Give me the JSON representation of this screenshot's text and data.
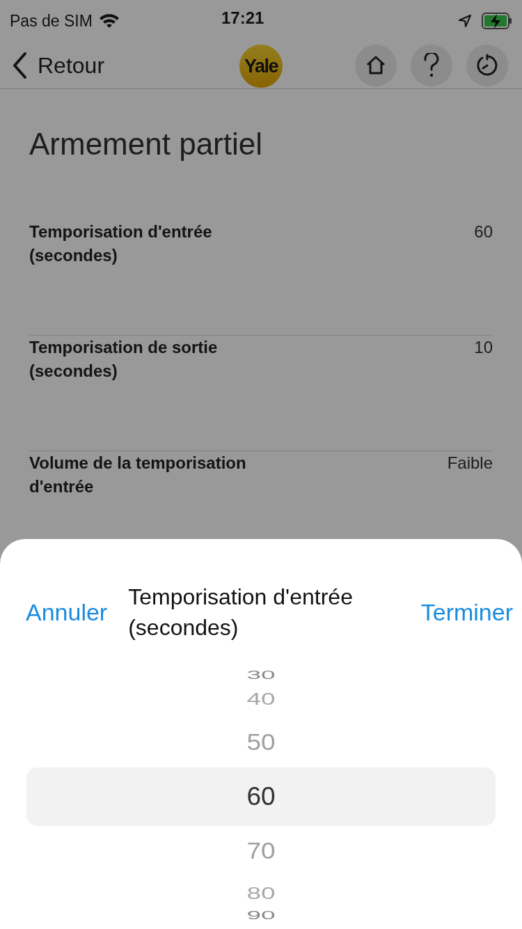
{
  "status_bar": {
    "carrier": "Pas de SIM",
    "time": "17:21"
  },
  "nav": {
    "back": "Retour",
    "logo": "Yale"
  },
  "title": "Armement partiel",
  "settings": [
    {
      "label": "Temporisation d'entrée (secondes)",
      "value": "60"
    },
    {
      "label": "Temporisation de sortie (secondes)",
      "value": "10"
    },
    {
      "label": "Volume de la temporisation d'entrée",
      "value": "Faible"
    }
  ],
  "sheet": {
    "cancel": "Annuler",
    "title": "Temporisation d'entrée (secondes)",
    "done": "Terminer",
    "options": [
      {
        "label": "30",
        "selected": false
      },
      {
        "label": "40",
        "selected": false
      },
      {
        "label": "50",
        "selected": false
      },
      {
        "label": "60",
        "selected": true
      },
      {
        "label": "70",
        "selected": false
      },
      {
        "label": "80",
        "selected": false
      },
      {
        "label": "90",
        "selected": false
      }
    ]
  }
}
